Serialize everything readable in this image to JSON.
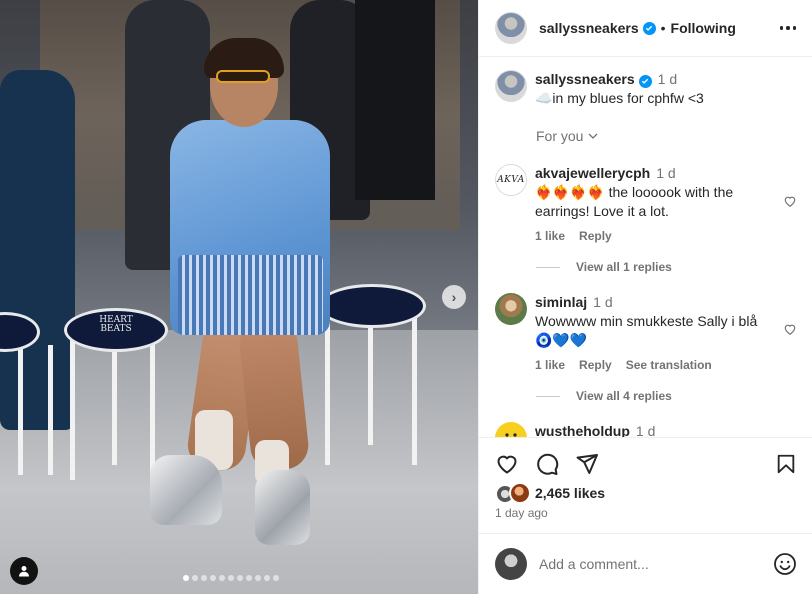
{
  "post": {
    "username": "sallyssneakers",
    "follow_status": "Following",
    "separator": "•",
    "caption": {
      "username": "sallyssneakers",
      "time": "1 d",
      "text": "☁️in my blues for cphfw <3"
    },
    "for_you_label": "For you",
    "carousel": {
      "slide_count": 11,
      "active_slide": 1
    }
  },
  "comments": [
    {
      "username": "akvajewellerycph",
      "avatar_text": "AKVA",
      "time": "1 d",
      "text": "❤️‍🔥❤️‍🔥❤️‍🔥❤️‍🔥 the loooook with the earrings! Love it a lot.",
      "likes": "1 like",
      "reply": "Reply",
      "view_replies": "View all 1 replies"
    },
    {
      "username": "siminlaj",
      "time": "1 d",
      "text": "Wowwww min smukkeste Sally i blå 🧿💙💙",
      "likes": "1 like",
      "reply": "Reply",
      "translate": "See translation",
      "view_replies": "View all 4 replies"
    },
    {
      "username": "wustheholdup",
      "time": "1 d"
    }
  ],
  "stool_label": "HEART BEATS",
  "engagement": {
    "likes": "2,465 likes",
    "date": "1 day ago"
  },
  "comment_box": {
    "placeholder": "Add a comment..."
  },
  "icons": {
    "more": "more-horizontal-icon",
    "like": "heart-icon",
    "comment": "comment-icon",
    "share": "send-icon",
    "save": "bookmark-icon",
    "emoji": "emoji-icon",
    "next": "chevron-right-icon",
    "user_tag": "user-icon"
  },
  "colors": {
    "verified": "#0095f6",
    "muted": "#737373",
    "text": "#262626"
  }
}
